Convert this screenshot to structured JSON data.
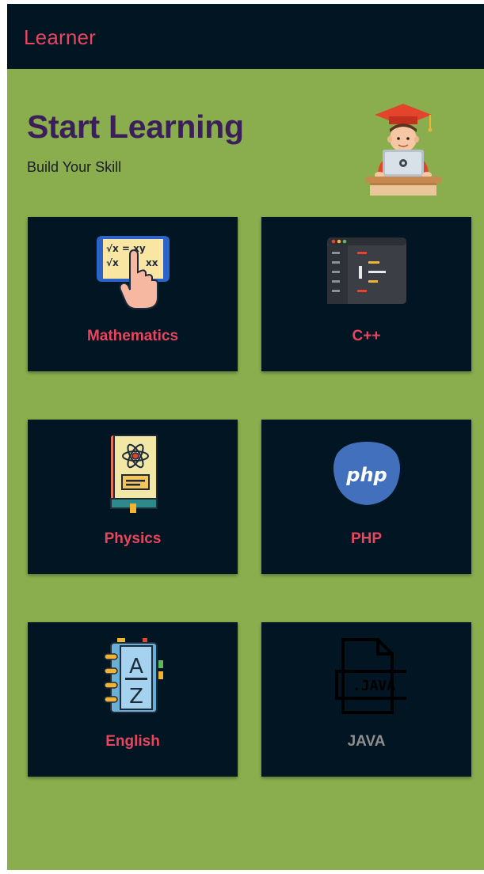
{
  "appbar": {
    "title": "Learner"
  },
  "hero": {
    "title": "Start Learning",
    "subtitle": "Build Your Skill",
    "illustration_icon": "student-laptop-icon"
  },
  "courses": [
    {
      "label": "Mathematics",
      "icon": "math-tablet-icon"
    },
    {
      "label": "C++",
      "icon": "code-editor-icon"
    },
    {
      "label": "Physics",
      "icon": "physics-book-icon"
    },
    {
      "label": "PHP",
      "icon": "php-logo-icon"
    },
    {
      "label": "English",
      "icon": "dictionary-az-icon"
    },
    {
      "label": "JAVA",
      "icon": "java-file-icon"
    }
  ],
  "math_icon_text": {
    "line1": "√x = xy",
    "line2": "√x",
    "line3": "xx"
  },
  "java_icon_text": ".JAVA",
  "php_icon_text": "php",
  "english_icon_text": {
    "top": "A",
    "bottom": "Z"
  },
  "colors": {
    "background": "#8AAE4E",
    "appbar": "#011522",
    "card": "#011522",
    "accent": "#E8455E",
    "heading": "#3A1F58",
    "muted_label": "#8E8E8E"
  }
}
